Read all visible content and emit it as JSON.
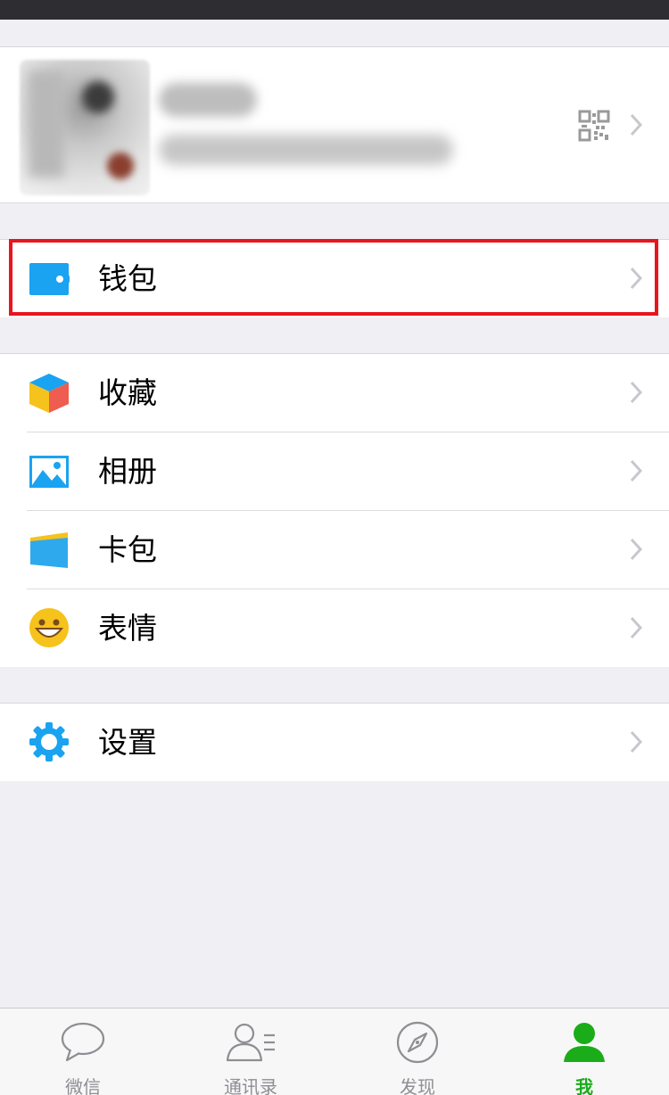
{
  "tabs": [
    {
      "label": "微信",
      "icon": "chat-icon"
    },
    {
      "label": "通讯录",
      "icon": "contacts-icon"
    },
    {
      "label": "发现",
      "icon": "compass-icon"
    },
    {
      "label": "我",
      "icon": "person-icon",
      "active": true
    }
  ],
  "menu": {
    "wallet": {
      "label": "钱包",
      "icon": "wallet-icon"
    },
    "favorites": {
      "label": "收藏",
      "icon": "cube-icon"
    },
    "album": {
      "label": "相册",
      "icon": "photo-icon"
    },
    "card_pack": {
      "label": "卡包",
      "icon": "card-icon"
    },
    "stickers": {
      "label": "表情",
      "icon": "smiley-icon"
    },
    "settings": {
      "label": "设置",
      "icon": "gear-icon"
    }
  },
  "colors": {
    "accent_green": "#1aad19",
    "icon_blue": "#1aa3f0",
    "highlight_red": "#e8151c",
    "background": "#efeff4"
  }
}
